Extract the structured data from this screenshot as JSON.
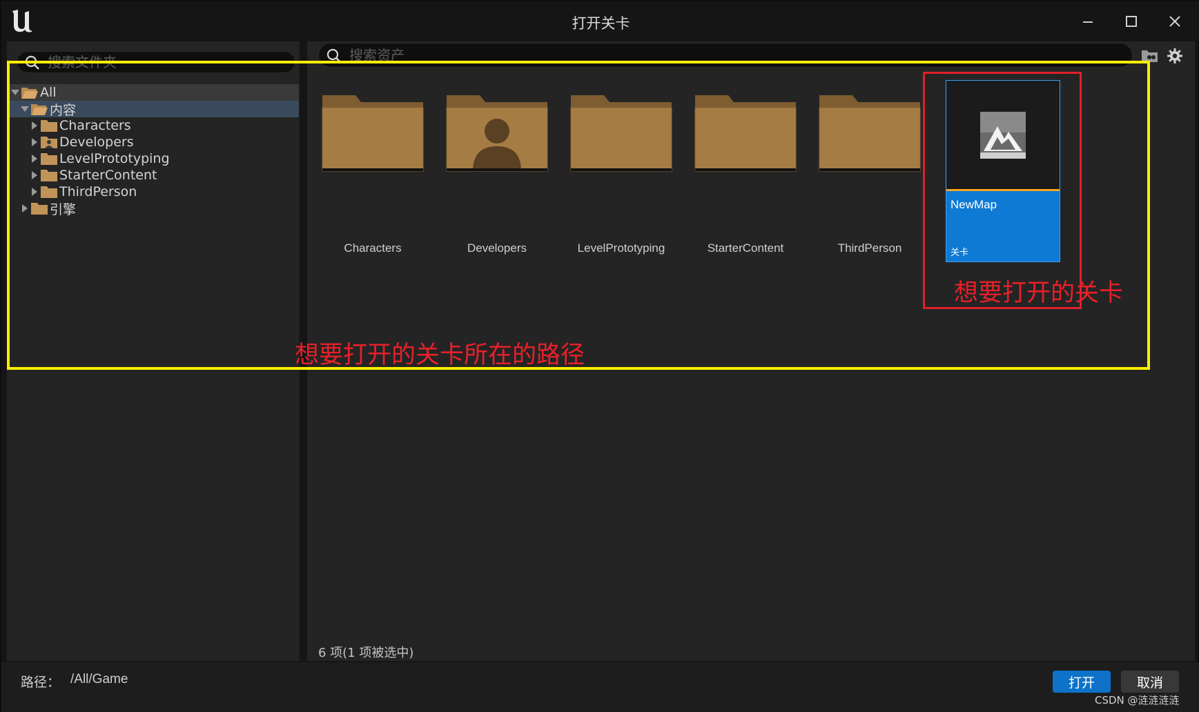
{
  "window": {
    "title": "打开关卡",
    "controls": {
      "minimize": "minimize-icon",
      "maximize": "maximize-icon",
      "close": "close-icon"
    }
  },
  "folder_panel": {
    "search_placeholder": "搜索文件夹",
    "tree": [
      {
        "label": "All",
        "depth": 0,
        "expanded": true,
        "state": "parent-selected"
      },
      {
        "label": "内容",
        "depth": 1,
        "expanded": true,
        "state": "selected"
      },
      {
        "label": "Characters",
        "depth": 2,
        "expanded": false
      },
      {
        "label": "Developers",
        "depth": 2,
        "expanded": false,
        "icon": "developer-folder-icon"
      },
      {
        "label": "LevelPrototyping",
        "depth": 2,
        "expanded": false
      },
      {
        "label": "StarterContent",
        "depth": 2,
        "expanded": false
      },
      {
        "label": "ThirdPerson",
        "depth": 2,
        "expanded": false
      },
      {
        "label": "引擎",
        "depth": 1,
        "expanded": false
      }
    ]
  },
  "asset_panel": {
    "search_placeholder": "搜索资产",
    "folders": [
      {
        "label": "Characters"
      },
      {
        "label": "Developers",
        "icon": "developer-folder-icon"
      },
      {
        "label": "LevelPrototyping"
      },
      {
        "label": "StarterContent"
      },
      {
        "label": "ThirdPerson"
      }
    ],
    "selected_asset": {
      "name": "NewMap",
      "type": "关卡"
    },
    "item_count": "6 项(1 项被选中)"
  },
  "footer": {
    "path_label": "路径：",
    "path_value": "/All/Game",
    "open_label": "打开",
    "cancel_label": "取消",
    "watermark": "CSDN @涟涟涟涟"
  },
  "annotations": {
    "folder_path_note": "想要打开的关卡所在的路径",
    "level_note": "想要打开的关卡"
  },
  "colors": {
    "accent": "#0e72c9",
    "folder": "#a67c45",
    "annotation_yellow": "#ffee00",
    "annotation_red": "#e0202a"
  }
}
